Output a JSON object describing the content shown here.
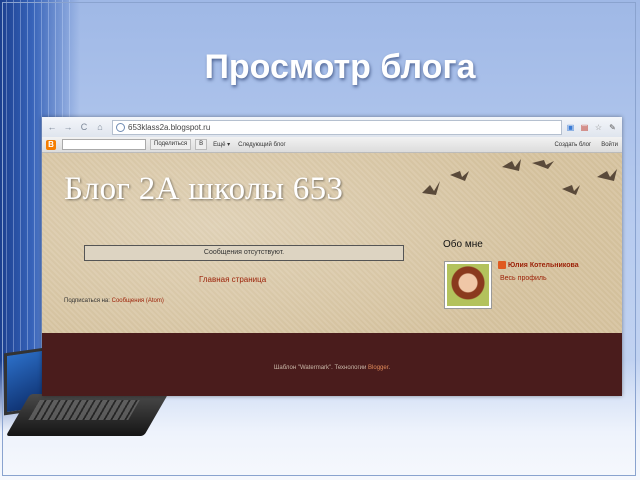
{
  "slide": {
    "title": "Просмотр блога"
  },
  "browser": {
    "url": "653klass2a.blogspot.ru",
    "nav": {
      "back": "←",
      "forward": "→",
      "reload": "C",
      "home": "⌂"
    },
    "toolbar_icons": [
      "page-icon",
      "pdf-icon",
      "star-icon",
      "wrench-icon"
    ]
  },
  "blogger_bar": {
    "logo": "B",
    "share_label": "Поделиться",
    "more_label": "Ещё",
    "next_blog_label": "Следующий блог",
    "create_blog_label": "Создать блог",
    "login_label": "Войти"
  },
  "blog": {
    "title": "Блог 2А школы 653",
    "no_posts": "Сообщения отсутствуют.",
    "home_link": "Главная страница",
    "subscribe_prefix": "Подписаться на:",
    "subscribe_link": "Сообщения (Atom)",
    "about": {
      "heading": "Обо мне",
      "name": "Юлия Котельникова",
      "full_profile": "Весь профиль"
    },
    "footer": {
      "prefix": "Шаблон \"Watermark\". Технологии",
      "link": "Blogger",
      "suffix": "."
    }
  },
  "colors": {
    "link": "#9b1f06",
    "footer_bg": "#4a1c1c",
    "page_bg": "#d9c7a6"
  }
}
